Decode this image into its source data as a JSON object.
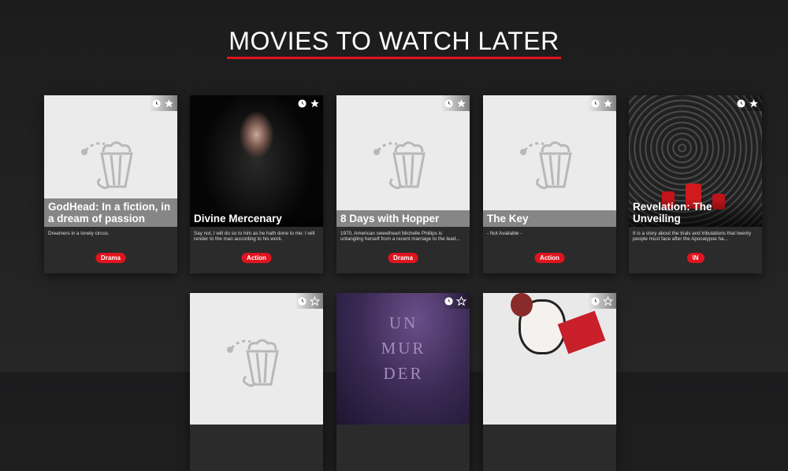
{
  "page_title": "MOVIES TO WATCH LATER",
  "movies": [
    {
      "title": "GodHead: In a fiction, in a dream of passion",
      "description": "Dreamers in a lonely circus.",
      "genre": "Drama",
      "poster": "placeholder",
      "favorite": true
    },
    {
      "title": "Divine Mercenary",
      "description": "Say not, I will do so to him as he hath done to me: I will render to the man according to his work.",
      "genre": "Action",
      "poster": "hooded-woman",
      "favorite": true
    },
    {
      "title": "8 Days with Hopper",
      "description": "1970, American sweetheart Michelle Phillips is untangling herself from a recent marriage to the lead...",
      "genre": "Drama",
      "poster": "placeholder",
      "favorite": true
    },
    {
      "title": "The Key",
      "description": "- Not Available -",
      "genre": "Action",
      "poster": "placeholder",
      "favorite": true
    },
    {
      "title": "Revelation: The Unveiling",
      "description": "It is a story about the trials and tribulations that twenty people must face after the Apocalypse ha...",
      "genre": "\\N",
      "poster": "smoke-candles",
      "favorite": true
    },
    {
      "poster": "placeholder",
      "favorite": false
    },
    {
      "poster": "unmurder",
      "poster_text": "UN MUR DER",
      "favorite": false
    },
    {
      "poster": "painted-face",
      "favorite": false
    }
  ]
}
